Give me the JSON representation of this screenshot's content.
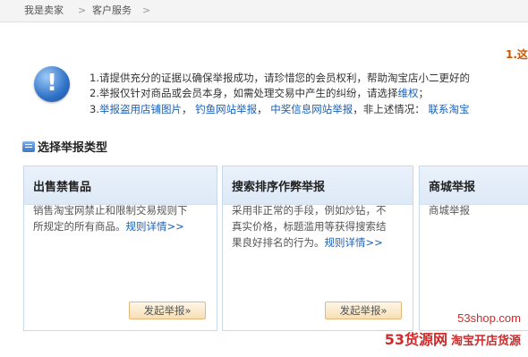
{
  "breadcrumb": {
    "items": [
      "我是卖家",
      "客户服务"
    ],
    "separator": ">"
  },
  "notice": {
    "heading": "1.这",
    "line1": "1.请提供充分的证据以确保举报成功，请珍惜您的会员权利，帮助淘宝店小二更好的",
    "line2_prefix": "2.举报仅针对商品或会员本身，如需处理交易中产生的纠纷，请选择",
    "line2_link": "维权",
    "line2_suffix": "；",
    "line3_prefix": "3.",
    "line3_links": [
      "举报盗用店铺图片",
      "钓鱼网站举报",
      "中奖信息网站举报"
    ],
    "line3_mid": "，非上述情况：",
    "line3_tail_link": "联系淘宝"
  },
  "section": {
    "title": "选择举报类型"
  },
  "cards": [
    {
      "title": "出售禁售品",
      "desc_lines": [
        "销售淘宝网禁止和限制交易规则下",
        "所规定的所有商品。"
      ],
      "rule_link": "规则详情>>",
      "button": "发起举报»"
    },
    {
      "title": "搜索排序作弊举报",
      "desc_lines": [
        "采用非正常的手段，例如炒钻，不",
        "真实价格，标题滥用等获得搜索结",
        "果良好排名的行为。"
      ],
      "rule_link": "规则详情>>",
      "button": "发起举报»"
    },
    {
      "title": "商城举报",
      "desc_lines": [
        "商城举报"
      ],
      "rule_link": "",
      "button": ""
    }
  ],
  "watermark": {
    "domain": "53shop.com",
    "brand": "53货源网",
    "tag": "淘宝开店货源"
  },
  "colors": {
    "link": "#1a5fb4",
    "heading_accent": "#cc5500",
    "watermark": "#d12a2a",
    "card_border": "#c8d8ea"
  }
}
